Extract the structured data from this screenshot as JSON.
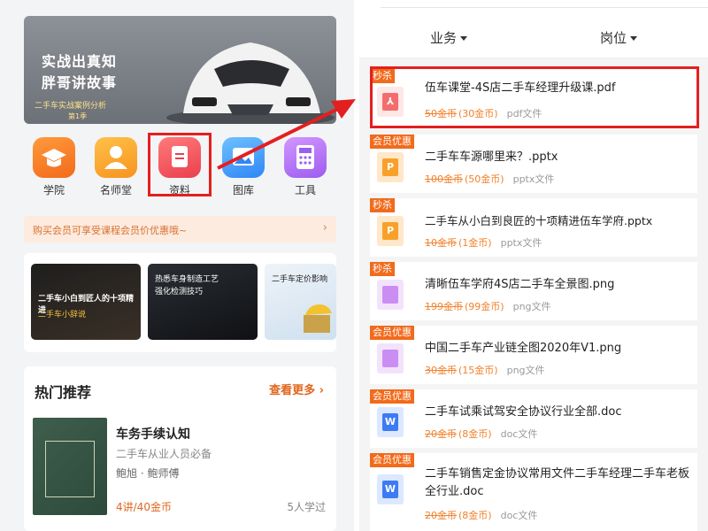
{
  "left": {
    "banner": {
      "line1": "实战出真知",
      "line2": "胖哥讲故事",
      "line3": "二手车实战案例分析",
      "line4": "第1季"
    },
    "categories": [
      {
        "label": "学院",
        "icon": "graduation-cap-icon"
      },
      {
        "label": "名师堂",
        "icon": "teacher-icon"
      },
      {
        "label": "资料",
        "icon": "document-icon"
      },
      {
        "label": "图库",
        "icon": "picture-icon"
      },
      {
        "label": "工具",
        "icon": "calculator-icon"
      }
    ],
    "promo": "购买会员可享受课程会员价优惠哦~",
    "courses": [
      {
        "title": "二手车小白到匠人的十项精进",
        "sub": "二手车小辞说"
      },
      {
        "title": "热悉车身制造工艺",
        "sub": "强化检测技巧"
      },
      {
        "title": "二手车定价影响",
        "sub": ""
      }
    ],
    "hot": {
      "title": "热门推荐",
      "more": "查看更多",
      "course": {
        "title": "车务手续认知",
        "sub": "二手车从业人员必备",
        "authors": "鲍旭 · 鲍师傅",
        "price": "4讲/40金币",
        "learners": "5人学过"
      }
    }
  },
  "right": {
    "filters": [
      "业务",
      "岗位"
    ],
    "files": [
      {
        "badge": "秒杀",
        "type": "pdf",
        "name": "伍车课堂-4S店二手车经理升级课.pdf",
        "orig": "50金币",
        "price": "(30金币)",
        "kind": "pdf文件"
      },
      {
        "badge": "会员优惠",
        "type": "ppt",
        "name": "二手车车源哪里来？.pptx",
        "orig": "100金币",
        "price": "(50金币)",
        "kind": "pptx文件"
      },
      {
        "badge": "秒杀",
        "type": "ppt",
        "name": "二手车从小白到良匠的十项精进伍车学府.pptx",
        "orig": "10金币",
        "price": "(1金币)",
        "kind": "pptx文件"
      },
      {
        "badge": "秒杀",
        "type": "img",
        "name": "清晰伍车学府4S店二手车全景图.png",
        "orig": "199金币",
        "price": "(99金币)",
        "kind": "png文件"
      },
      {
        "badge": "会员优惠",
        "type": "img",
        "name": "中国二手车产业链全图2020年V1.png",
        "orig": "30金币",
        "price": "(15金币)",
        "kind": "png文件"
      },
      {
        "badge": "会员优惠",
        "type": "doc",
        "name": "二手车试乘试驾安全协议行业全部.doc",
        "orig": "20金币",
        "price": "(8金币)",
        "kind": "doc文件"
      },
      {
        "badge": "会员优惠",
        "type": "doc",
        "name": "二手车销售定金协议常用文件二手车经理二手车老板全行业.doc",
        "orig": "20金币",
        "price": "(8金币)",
        "kind": "doc文件"
      }
    ]
  },
  "colors": {
    "highlight": "#e41f1f",
    "accent": "#f26a1b"
  }
}
